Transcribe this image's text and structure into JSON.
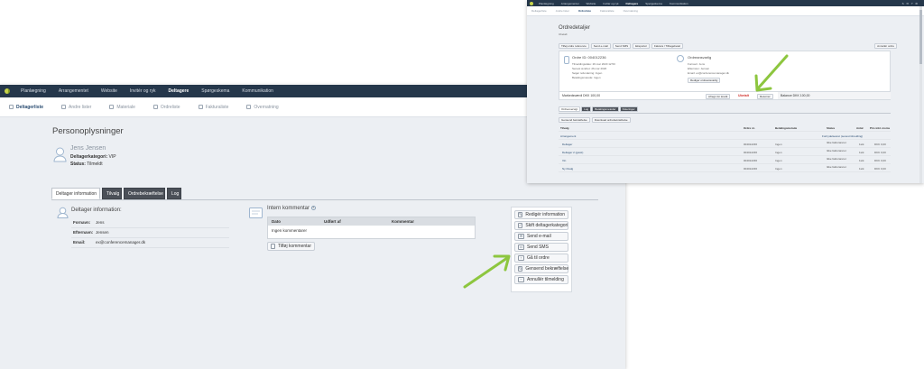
{
  "left": {
    "topnav": [
      "Planlægning",
      "Arrangementet",
      "Website",
      "Invitér og ryk",
      "Deltagere",
      "Spørgeskema",
      "Kommunikation"
    ],
    "topnav_active": 4,
    "subnav": [
      "Deltagerliste",
      "Andre lister",
      "Materiale",
      "Ordreliste",
      "Fakturaliste",
      "Overnatning"
    ],
    "subnav_active": 0,
    "page_title": "Personoplysninger",
    "person": {
      "name": "Jens Jensen",
      "category_label": "Deltagerkategori:",
      "category_value": "VIP",
      "status_label": "Status:",
      "status_value": "Tilmeldt"
    },
    "tabs": [
      "Deltager information",
      "Tilvalg",
      "Ordrebekræftelse",
      "Log"
    ],
    "tab_active": 0,
    "info": {
      "heading": "Deltager information:",
      "fields": [
        {
          "label": "Fornavn:",
          "value": "Jens"
        },
        {
          "label": "Efternavn:",
          "value": "Jensen"
        },
        {
          "label": "Email:",
          "value": "ex@conferencemanager.dk"
        }
      ]
    },
    "comment": {
      "heading": "Intern kommentar",
      "columns": [
        "Dato",
        "Udført af",
        "Kommentar"
      ],
      "empty_text": "Ingen kommentarer",
      "add_label": "Tilføj kommentar"
    },
    "actions": [
      "Redigér information",
      "Skift deltagerkategori",
      "Send e-mail",
      "Send SMS",
      "Gå til ordre",
      "Gensend bekræftelse",
      "Annullér tilmelding"
    ],
    "actions_icons": [
      "pencil-icon",
      "checkmark-icon",
      "envelope-icon",
      "sms-icon",
      "arrow-right-icon",
      "refresh-icon",
      "minus-icon"
    ]
  },
  "right": {
    "topnav": [
      "Planlægning",
      "Arrangementet",
      "Website",
      "Invitér og ryk",
      "Deltagere",
      "Spørgeskema",
      "Kommunikation"
    ],
    "topnav_active": 4,
    "top_right": "S  ✉  ?  ⚙",
    "subnav": [
      "Deltagerliste",
      "Andre lister",
      "Ordreliste",
      "Fakturaliste",
      "Overnatning"
    ],
    "subnav_active": 2,
    "title": "Ordredetaljer",
    "subtitle": "Ubetalt",
    "toolbar": [
      "Tilføj ordre reference",
      "Send e-mail",
      "Send SMS",
      "Eksportér",
      "Faktura / Tilbagebetal"
    ],
    "cancel_order": "Annullér ordre",
    "order_id_label": "Ordre ID: 004012236",
    "order_lines": [
      "Tilmeldingsdato: 26.mar 2020 12:50",
      "Senest ændret: 26.mar 2020",
      "Søger refundering: Ingen",
      "Betalingsmetode: Ingen"
    ],
    "owner_heading": "Ordreansvarlig",
    "owner_lines": [
      "Fornavn: Jens",
      "Efternavn: Jensen",
      "Email: ex@conferencemanager.dk"
    ],
    "owner_edit": "Rediger ordreansvarlig",
    "total_label": "Markedsværdi DKK 100,00",
    "pay_button": "Afregn for kredit",
    "status_text": "Ubetalt",
    "return_button": "Returnér",
    "balance": "Balance DKK 100,00",
    "tabs": [
      "Ordreoversigt",
      "Log",
      "Betalingsmetoder",
      "Noteringer"
    ],
    "sub_buttons": [
      "Gensend bekræftelse",
      "Download ordrebekræftelse"
    ],
    "columns": [
      "Tilvalg",
      "Ordre nr.",
      "Betalingsmetode",
      "Status",
      "Antal",
      "Pris inkl. moms"
    ],
    "group_label": "Arrangement",
    "group_right": "Fortrydelsesret (senest tilmelding)",
    "rows": [
      {
        "name": "Deltager",
        "order": "004012236",
        "method": "Ingen",
        "status": "Ikke fakturareret",
        "qty": "1stk",
        "price": "DKK 0,00"
      },
      {
        "name": "Deltager 2 (gæst)",
        "order": "004012236",
        "method": "Ingen",
        "status": "Ikke fakturareret",
        "qty": "1stk",
        "price": "DKK 0,00"
      },
      {
        "name": "Vin",
        "order": "004012236",
        "method": "Ingen",
        "status": "Ikke fakturareret",
        "qty": "1stk",
        "price": "DKK 0,00"
      },
      {
        "name": "Ny tilvalg",
        "order": "004012236",
        "method": "Ingen",
        "status": "Ikke fakturareret",
        "qty": "1stk",
        "price": "DKK 0,00"
      }
    ]
  },
  "colors": {
    "nav": "#25374b",
    "accent_arrow": "#8dc63f",
    "page_bg": "#eceff3"
  }
}
